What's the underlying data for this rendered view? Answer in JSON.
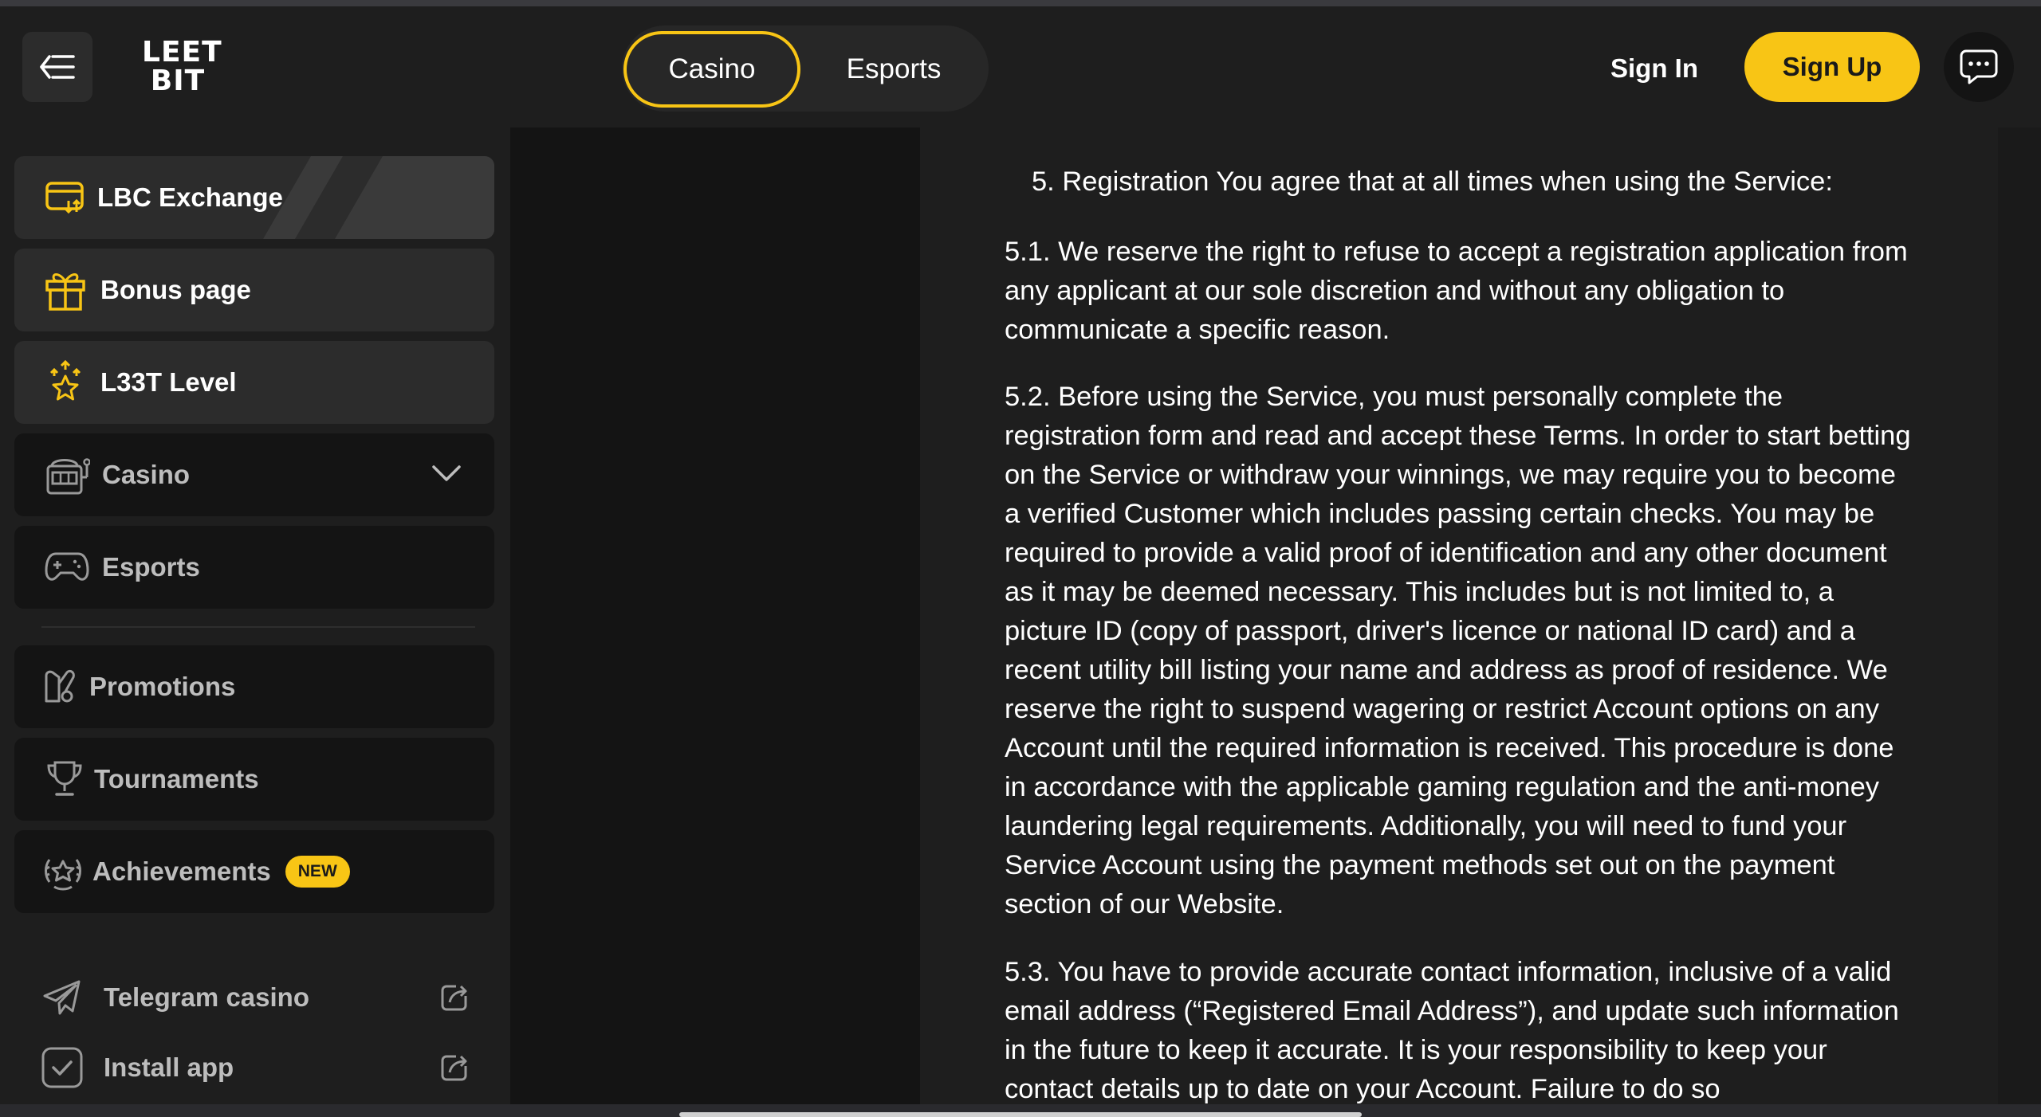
{
  "header": {
    "logo_line1": "LEET",
    "logo_line2": "BIT",
    "tabs": [
      "Casino",
      "Esports"
    ],
    "sign_in": "Sign In",
    "sign_up": "Sign Up"
  },
  "sidebar": {
    "featured": [
      {
        "label": "LBC Exchange",
        "icon": "exchange-icon"
      },
      {
        "label": "Bonus page",
        "icon": "gift-icon"
      },
      {
        "label": "L33T Level",
        "icon": "star-level-icon"
      }
    ],
    "sections": [
      {
        "label": "Casino",
        "icon": "slot-machine-icon"
      },
      {
        "label": "Esports",
        "icon": "gamepad-icon"
      }
    ],
    "extras": [
      {
        "label": "Promotions",
        "icon": "promotions-icon"
      },
      {
        "label": "Tournaments",
        "icon": "trophy-icon"
      },
      {
        "label": "Achievements",
        "icon": "achievement-icon",
        "badge": "NEW"
      }
    ],
    "links": [
      {
        "label": "Telegram casino",
        "icon": "telegram-icon"
      },
      {
        "label": "Install app",
        "icon": "install-app-icon"
      }
    ]
  },
  "content": {
    "p5": "5. Registration You agree that at all times when using the Service:",
    "p51": "5.1. We reserve the right to refuse to accept a registration application from any applicant at our sole discretion and without any obligation to communicate a specific reason.",
    "p52": "5.2. Before using the Service, you must personally complete the registration form and read and accept these Terms. In order to start betting on the Service or withdraw your winnings, we may require you to become a verified Customer which includes passing certain checks. You may be required to provide a valid proof of identification and any other document as it may be deemed necessary. This includes but is not limited to, a picture ID (copy of passport, driver's licence or national ID card) and a recent utility bill listing your name and address as proof of residence. We reserve the right to suspend wagering or restrict Account options on any Account until the required information is received. This procedure is done in accordance with the applicable gaming regulation and the anti-money laundering legal requirements. Additionally, you will need to fund your Service Account using the payment methods set out on the payment section of our Website.",
    "p53": "5.3. You have to provide accurate contact information, inclusive of a valid email address (“Registered Email Address”), and update such information in the future to keep it accurate. It is your responsibility to keep your contact details up to date on your Account. Failure to do so"
  },
  "colors": {
    "accent": "#f8c515",
    "background": "#1a1a1a",
    "panel": "#1e1e1e",
    "item": "#141414",
    "featured_item": "#2c2c2c"
  }
}
